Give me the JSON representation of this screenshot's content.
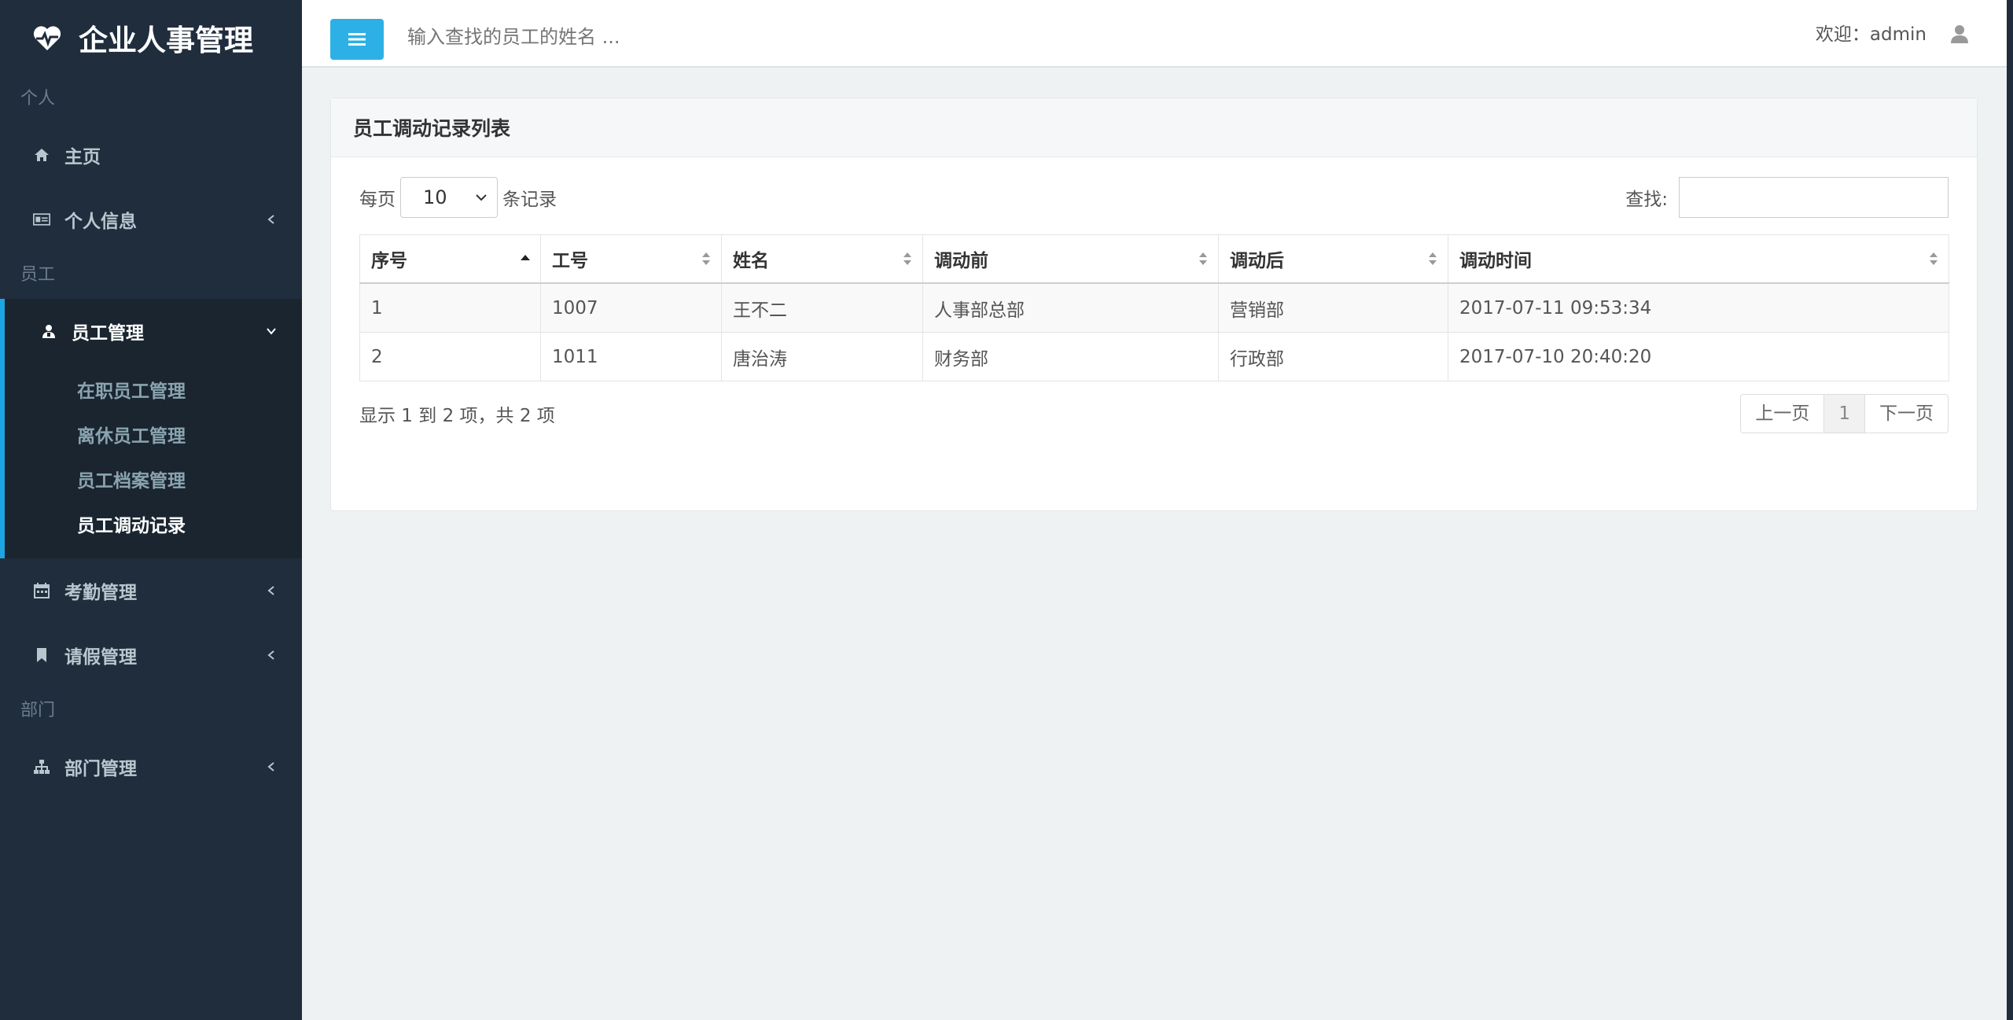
{
  "brand": {
    "title": "企业人事管理"
  },
  "sidebar": {
    "sections": [
      {
        "label": "个人"
      },
      {
        "label": "员工"
      },
      {
        "label": "部门"
      }
    ],
    "items": {
      "home": "主页",
      "profile": "个人信息",
      "employee": "员工管理",
      "attendance": "考勤管理",
      "leave": "请假管理",
      "department": "部门管理"
    },
    "employee_sub": [
      "在职员工管理",
      "离休员工管理",
      "员工档案管理",
      "员工调动记录"
    ]
  },
  "topbar": {
    "search_placeholder": "输入查找的员工的姓名 ...",
    "welcome": "欢迎：admin"
  },
  "box": {
    "title": "员工调动记录列表",
    "length_prefix": "每页",
    "length_value": "10",
    "length_suffix": "条记录",
    "search_label": "查找:",
    "columns": [
      "序号",
      "工号",
      "姓名",
      "调动前",
      "调动后",
      "调动时间"
    ],
    "rows": [
      [
        "1",
        "1007",
        "王不二",
        "人事部总部",
        "营销部",
        "2017-07-11 09:53:34"
      ],
      [
        "2",
        "1011",
        "唐治涛",
        "财务部",
        "行政部",
        "2017-07-10 20:40:20"
      ]
    ],
    "info": "显示 1 到 2 项，共 2 项",
    "pager": {
      "prev": "上一页",
      "current": "1",
      "next": "下一页"
    }
  },
  "colors": {
    "accent": "#1fa4e3",
    "sidebar_bg": "#1f2d3d",
    "button": "#2cb0e6"
  }
}
